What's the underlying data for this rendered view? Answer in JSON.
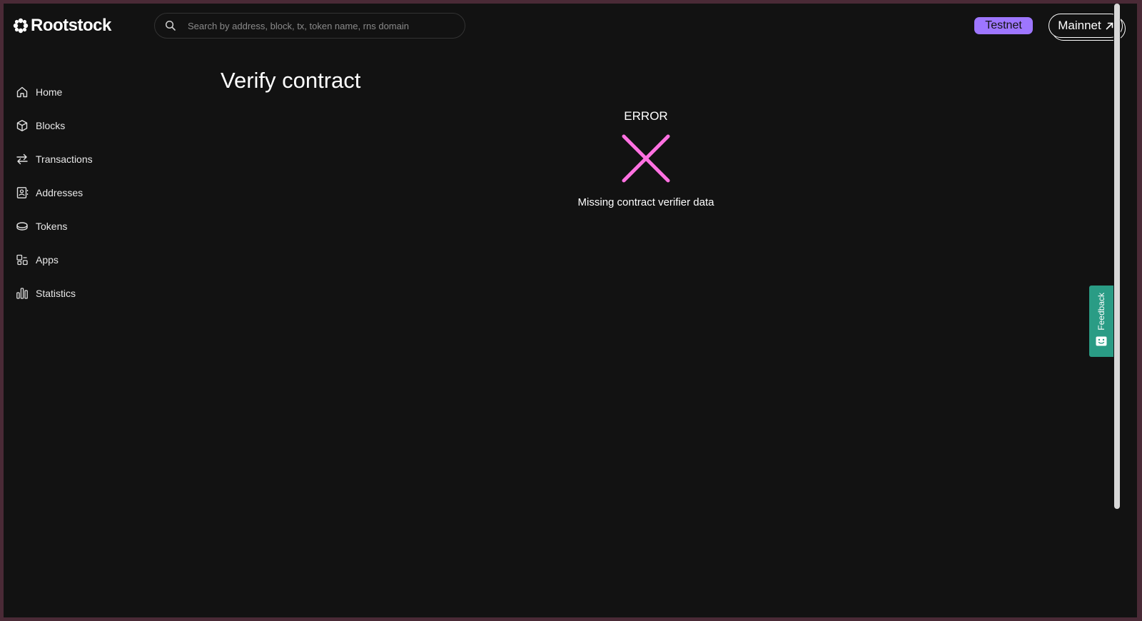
{
  "brand": {
    "name": "Rootstock"
  },
  "search": {
    "placeholder": "Search by address, block, tx, token name, rns domain"
  },
  "networks": {
    "testnet": "Testnet",
    "mainnet": "Mainnet"
  },
  "sidebar": {
    "items": [
      {
        "label": "Home",
        "icon": "home-icon"
      },
      {
        "label": "Blocks",
        "icon": "cube-icon"
      },
      {
        "label": "Transactions",
        "icon": "arrows-swap-icon"
      },
      {
        "label": "Addresses",
        "icon": "contact-book-icon"
      },
      {
        "label": "Tokens",
        "icon": "coin-icon"
      },
      {
        "label": "Apps",
        "icon": "apps-icon"
      },
      {
        "label": "Statistics",
        "icon": "bar-chart-icon"
      }
    ]
  },
  "main": {
    "title": "Verify contract",
    "status": "ERROR",
    "message": "Missing contract verifier data",
    "status_icon": "error-x-icon"
  },
  "feedback": {
    "label": "Feedback"
  },
  "colors": {
    "background": "#121212",
    "accent_purple": "#9e76ff",
    "error_pink": "#ff71e1",
    "feedback_green": "#2a9c85"
  }
}
